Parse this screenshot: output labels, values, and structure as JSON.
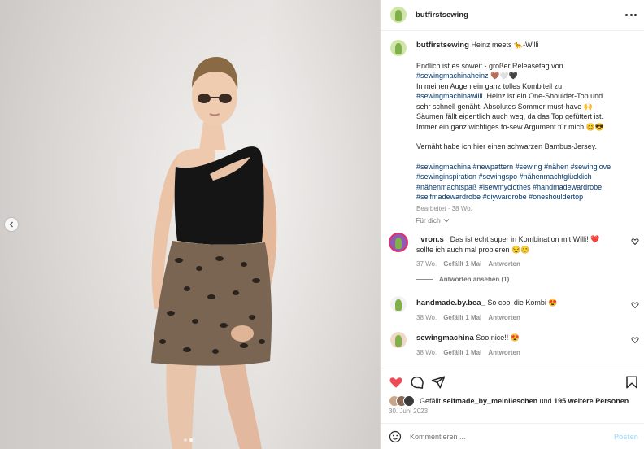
{
  "post": {
    "username": "butfirstsewing",
    "more_icon": "more-horizontal-icon"
  },
  "caption": {
    "username": "butfirstsewing",
    "title_line": "Heinz meets 🐆-Willi",
    "line1": "Endlich ist es soweit - großer Releasetag von",
    "line2_tag": "#sewingmachinaheinz",
    "line2_emoji": "🤎🤍🖤",
    "line3": "In meinen Augen ein ganz tolles Kombiteil zu",
    "line4_tag": "#sewingmachinawilli",
    "line4_text": ". Heinz ist ein One-Shoulder-Top und",
    "line5": "sehr schnell genäht. Absolutes Sommer must-have 🙌",
    "line6": "Säumen fällt eigentlich auch weg, da das Top gefüttert ist.",
    "line7": "Immer ein ganz wichtiges to-sew Argument für mich 😊😎",
    "line8": "Vernäht habe ich hier einen schwarzen Bambus-Jersey.",
    "hashtags": [
      "#sewingmachina #newpattern #sewing #nähen #sewinglove",
      "#sewinginspiration #sewingspo #nähenmachtglücklich",
      "#nähenmachtspaß #isewmyclothes #handmadewardrobe",
      "#selfmadewardrobe #diywardrobe #oneshouldertop"
    ],
    "meta": "Bearbeitet · 38 Wo."
  },
  "for_you": "Für dich",
  "comments": [
    {
      "user": "_vron.s_",
      "text_line1": "Das ist echt super in Kombination mit Willi! ❤️",
      "text_line2": "sollte ich auch mal probieren 😏😊",
      "age": "37 Wo.",
      "likes": "Gefällt 1 Mal",
      "reply": "Antworten",
      "view_replies": "Antworten ansehen (1)"
    },
    {
      "user": "handmade.by.bea_",
      "text_line1": "So cool die Kombi 😍",
      "age": "38 Wo.",
      "likes": "Gefällt 1 Mal",
      "reply": "Antworten"
    },
    {
      "user": "sewingmachina",
      "text_line1": "Soo nice!! 😍",
      "age": "38 Wo.",
      "likes": "Gefällt 1 Mal",
      "reply": "Antworten"
    }
  ],
  "likes": {
    "prefix": "Gefällt",
    "user": "selfmade_by_meinlieschen",
    "middle": "und",
    "others": "195 weitere Personen"
  },
  "date": "30. Juni 2023",
  "comment_box": {
    "placeholder": "Kommentieren ...",
    "post_label": "Posten"
  },
  "colors": {
    "like_red": "#ed4956",
    "tag_blue": "#00376b",
    "post_disabled": "#b2dffc"
  }
}
